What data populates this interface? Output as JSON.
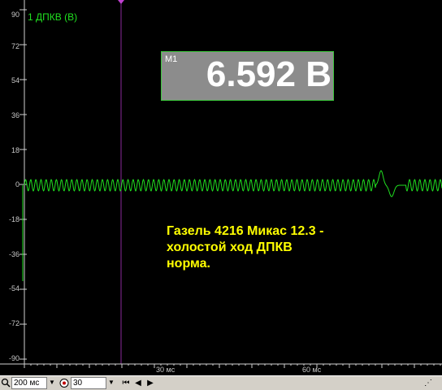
{
  "channel": {
    "label": "1 ДПКВ (В)",
    "trace_color": "#20e020"
  },
  "y_axis": {
    "ticks": [
      "90",
      "72",
      "54",
      "36",
      "18",
      "0",
      "-18",
      "-36",
      "-54",
      "-72",
      "-90"
    ]
  },
  "x_axis": {
    "ticks": [
      "30 мс",
      "60 мс"
    ]
  },
  "measurement": {
    "name": "M1",
    "value": "6.592 В"
  },
  "annotation": {
    "lines": [
      "Газель 4216 Микас 12.3 -",
      "холостой ход ДПКВ",
      "норма."
    ],
    "color": "#ffff00"
  },
  "statusbar": {
    "timebase": "200 мс",
    "count": "30"
  }
}
